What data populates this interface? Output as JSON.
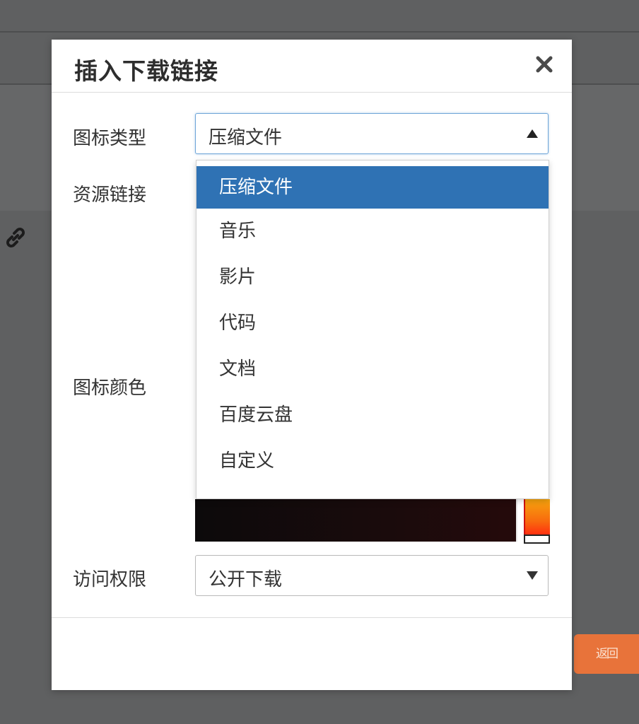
{
  "dialog": {
    "title": "插入下载链接",
    "close_icon": "close-icon"
  },
  "form": {
    "icon_type_label": "图标类型",
    "resource_link_label": "资源链接",
    "icon_color_label": "图标颜色",
    "access_label": "访问权限"
  },
  "icon_type_select": {
    "value": "压缩文件",
    "expanded": true,
    "options": [
      {
        "label": "压缩文件",
        "selected": true
      },
      {
        "label": "音乐",
        "selected": false
      },
      {
        "label": "影片",
        "selected": false
      },
      {
        "label": "代码",
        "selected": false
      },
      {
        "label": "文档",
        "selected": false
      },
      {
        "label": "百度云盘",
        "selected": false
      },
      {
        "label": "自定义",
        "selected": false
      }
    ]
  },
  "access_select": {
    "value": "公开下载"
  },
  "background": {
    "orange_button_text": "返回",
    "link_icon": "link-icon"
  },
  "colors": {
    "selected_option_bg": "#2f72b4",
    "accent_orange": "#e8733a",
    "overlay": "#5f6061"
  }
}
